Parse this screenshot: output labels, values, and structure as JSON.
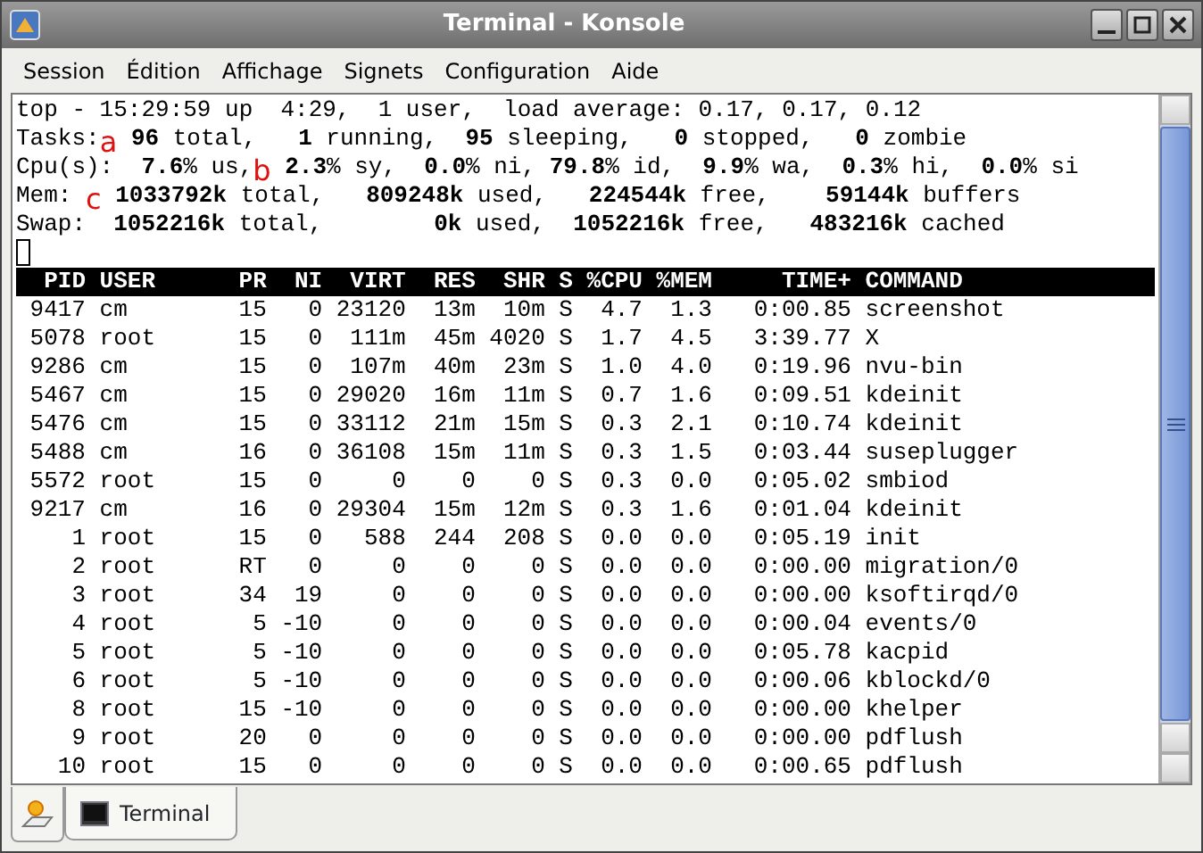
{
  "window": {
    "title": "Terminal - Konsole"
  },
  "menu": [
    "Session",
    "Édition",
    "Affichage",
    "Signets",
    "Configuration",
    "Aide"
  ],
  "summary": [
    {
      "parts": [
        "top - 15:29:59 up  4:29,  1 user,  load average: 0.17, 0.17, 0.12"
      ]
    },
    {
      "parts": [
        "Tasks:",
        " **96** total,   **1** running,  **95** sleeping,   **0** stopped,   **0** zombie"
      ],
      "annotation": "a"
    },
    {
      "parts": [
        "Cpu(s):  **7.6**% us,",
        " **2.3**% sy,  **0.0**% ni, **79.8**% id,  **9.9**% wa,  **0.3**% hi,  **0.0**% si"
      ],
      "annotation": "b"
    },
    {
      "parts": [
        "Mem: ",
        " **1033792k** total,   **809248k** used,   **224544k** free,    **59144k** buffers"
      ],
      "annotation": "c"
    },
    {
      "parts": [
        "Swap:  **1052216k** total,        **0k** used,  **1052216k** free,   **483216k** cached"
      ]
    }
  ],
  "process_table": {
    "columns": [
      "PID",
      "USER",
      "PR",
      "NI",
      "VIRT",
      "RES",
      "SHR",
      "S",
      "%CPU",
      "%MEM",
      "TIME+",
      "COMMAND"
    ],
    "rows": [
      [
        "9417",
        "cm",
        "15",
        "0",
        "23120",
        "13m",
        "10m",
        "S",
        "4.7",
        "1.3",
        "0:00.85",
        "screenshot"
      ],
      [
        "5078",
        "root",
        "15",
        "0",
        "111m",
        "45m",
        "4020",
        "S",
        "1.7",
        "4.5",
        "3:39.77",
        "X"
      ],
      [
        "9286",
        "cm",
        "15",
        "0",
        "107m",
        "40m",
        "23m",
        "S",
        "1.0",
        "4.0",
        "0:19.96",
        "nvu-bin"
      ],
      [
        "5467",
        "cm",
        "15",
        "0",
        "29020",
        "16m",
        "11m",
        "S",
        "0.7",
        "1.6",
        "0:09.51",
        "kdeinit"
      ],
      [
        "5476",
        "cm",
        "15",
        "0",
        "33112",
        "21m",
        "15m",
        "S",
        "0.3",
        "2.1",
        "0:10.74",
        "kdeinit"
      ],
      [
        "5488",
        "cm",
        "16",
        "0",
        "36108",
        "15m",
        "11m",
        "S",
        "0.3",
        "1.5",
        "0:03.44",
        "suseplugger"
      ],
      [
        "5572",
        "root",
        "15",
        "0",
        "0",
        "0",
        "0",
        "S",
        "0.3",
        "0.0",
        "0:05.02",
        "smbiod"
      ],
      [
        "9217",
        "cm",
        "16",
        "0",
        "29304",
        "15m",
        "12m",
        "S",
        "0.3",
        "1.6",
        "0:01.04",
        "kdeinit"
      ],
      [
        "1",
        "root",
        "15",
        "0",
        "588",
        "244",
        "208",
        "S",
        "0.0",
        "0.0",
        "0:05.19",
        "init"
      ],
      [
        "2",
        "root",
        "RT",
        "0",
        "0",
        "0",
        "0",
        "S",
        "0.0",
        "0.0",
        "0:00.00",
        "migration/0"
      ],
      [
        "3",
        "root",
        "34",
        "19",
        "0",
        "0",
        "0",
        "S",
        "0.0",
        "0.0",
        "0:00.00",
        "ksoftirqd/0"
      ],
      [
        "4",
        "root",
        "5",
        "-10",
        "0",
        "0",
        "0",
        "S",
        "0.0",
        "0.0",
        "0:00.04",
        "events/0"
      ],
      [
        "5",
        "root",
        "5",
        "-10",
        "0",
        "0",
        "0",
        "S",
        "0.0",
        "0.0",
        "0:05.78",
        "kacpid"
      ],
      [
        "6",
        "root",
        "5",
        "-10",
        "0",
        "0",
        "0",
        "S",
        "0.0",
        "0.0",
        "0:00.06",
        "kblockd/0"
      ],
      [
        "8",
        "root",
        "15",
        "-10",
        "0",
        "0",
        "0",
        "S",
        "0.0",
        "0.0",
        "0:00.00",
        "khelper"
      ],
      [
        "9",
        "root",
        "20",
        "0",
        "0",
        "0",
        "0",
        "S",
        "0.0",
        "0.0",
        "0:00.00",
        "pdflush"
      ],
      [
        "10",
        "root",
        "15",
        "0",
        "0",
        "0",
        "0",
        "S",
        "0.0",
        "0.0",
        "0:00.65",
        "pdflush"
      ]
    ]
  },
  "tabs": [
    {
      "label": "Terminal",
      "selected": true
    }
  ]
}
